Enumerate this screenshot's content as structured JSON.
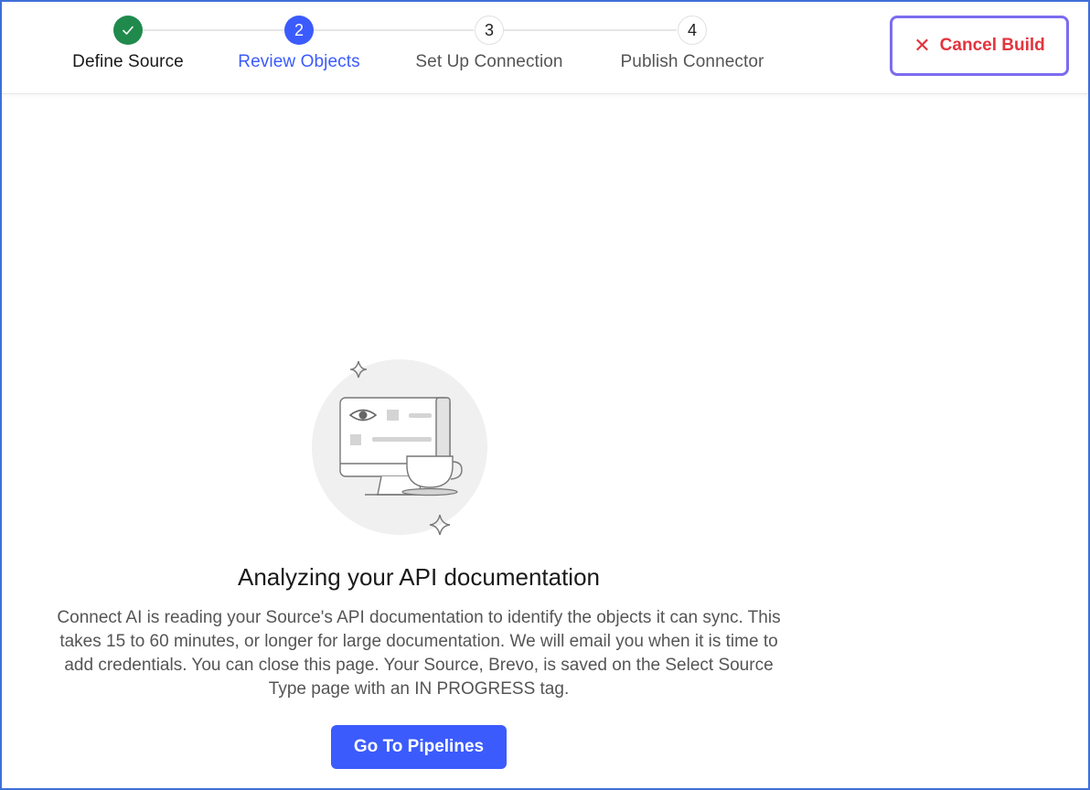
{
  "stepper": {
    "steps": [
      {
        "number": "",
        "label": "Define Source",
        "state": "done"
      },
      {
        "number": "2",
        "label": "Review Objects",
        "state": "current"
      },
      {
        "number": "3",
        "label": "Set Up Connection",
        "state": "todo"
      },
      {
        "number": "4",
        "label": "Publish Connector",
        "state": "todo"
      }
    ]
  },
  "header": {
    "cancel_icon": "✕",
    "cancel_label": "Cancel Build"
  },
  "main": {
    "title": "Analyzing your API documentation",
    "description": "Connect AI is reading your Source's API documentation to identify the objects it can sync. This takes 15 to 60 minutes, or longer for large documentation. We will email you when it is time to add credentials. You can close this page. Your Source, Brevo, is saved on the Select Source Type page with an IN PROGRESS tag.",
    "button_label": "Go To Pipelines"
  },
  "colors": {
    "accent": "#3b5bfd",
    "done": "#1f8a4c",
    "danger": "#e3343e",
    "focus_ring": "#7b6cf0"
  }
}
